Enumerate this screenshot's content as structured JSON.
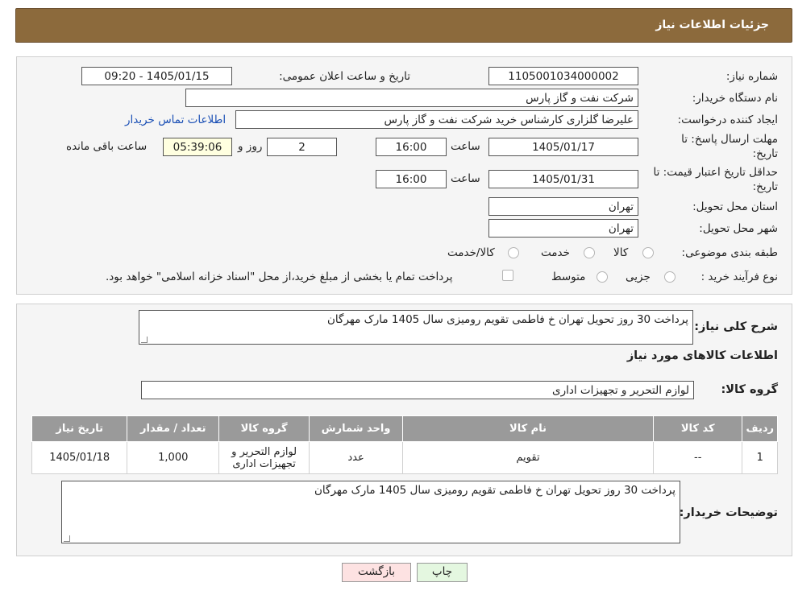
{
  "header": {
    "title": "جزئیات اطلاعات نیاز"
  },
  "form": {
    "need_number_label": "شماره نیاز:",
    "need_number": "1105001034000002",
    "announce_label": "تاریخ و ساعت اعلان عمومی:",
    "announce_value": "1405/01/15 - 09:20",
    "buyer_org_label": "نام دستگاه خریدار:",
    "buyer_org": "شرکت نفت و گاز پارس",
    "creator_label": "ایجاد کننده درخواست:",
    "creator": "علیرضا  گلزاری کارشناس خرید  شرکت نفت و گاز پارس",
    "contact_link": "اطلاعات تماس خریدار",
    "deadline_label_1": "مهلت ارسال پاسخ: تا",
    "deadline_label_2": "تاریخ:",
    "deadline_date": "1405/01/17",
    "time_label": "ساعت",
    "deadline_time": "16:00",
    "days_value": "2",
    "days_label": "روز و",
    "remaining_time": "05:39:06",
    "remaining_label": "ساعت باقی مانده",
    "validity_label_1": "حداقل تاریخ اعتبار قیمت: تا",
    "validity_label_2": "تاریخ:",
    "validity_date": "1405/01/31",
    "validity_time_label": "ساعت",
    "validity_time": "16:00",
    "province_label": "استان محل تحویل:",
    "province": "تهران",
    "city_label": "شهر محل تحویل:",
    "city": "تهران",
    "category_label": "طبقه بندی موضوعی:",
    "category_options": [
      "کالا",
      "خدمت",
      "کالا/خدمت"
    ],
    "purchase_type_label": "نوع فرآیند خرید :",
    "purchase_options": [
      "جزیی",
      "متوسط"
    ],
    "payment_note": "پرداخت تمام یا بخشی از مبلغ خرید،از محل \"اسناد خزانه اسلامی\" خواهد بود."
  },
  "details": {
    "summary_label": "شرح کلی نیاز:",
    "summary": "پرداخت 30 روز تحویل تهران خ فاطمی تقویم رومیزی سال 1405 مارک مهرگان",
    "items_info_title": "اطلاعات کالاهای مورد نیاز",
    "group_label": "گروه کالا:",
    "group_value": "لوازم التحریر و تجهیزات اداری",
    "table": {
      "headers": [
        "ردیف",
        "کد کالا",
        "نام کالا",
        "واحد شمارش",
        "گروه کالا",
        "تعداد / مقدار",
        "تاریخ نیاز"
      ],
      "rows": [
        [
          "1",
          "--",
          "تقویم",
          "عدد",
          "لوازم التحریر و تجهیزات اداری",
          "1,000",
          "1405/01/18"
        ]
      ]
    },
    "buyer_notes_label": "توضیحات خریدار:",
    "buyer_notes": "پرداخت 30 روز تحویل تهران خ فاطمی تقویم رومیزی سال 1405 مارک مهرگان"
  },
  "buttons": {
    "print": "چاپ",
    "back": "بازگشت"
  },
  "colors": {
    "header_bg": "#8c6a3c",
    "link": "#1a4fb5",
    "table_header": "#9a9a9a",
    "back_btn": "#fde2e2",
    "print_btn": "#e4f7e0"
  }
}
